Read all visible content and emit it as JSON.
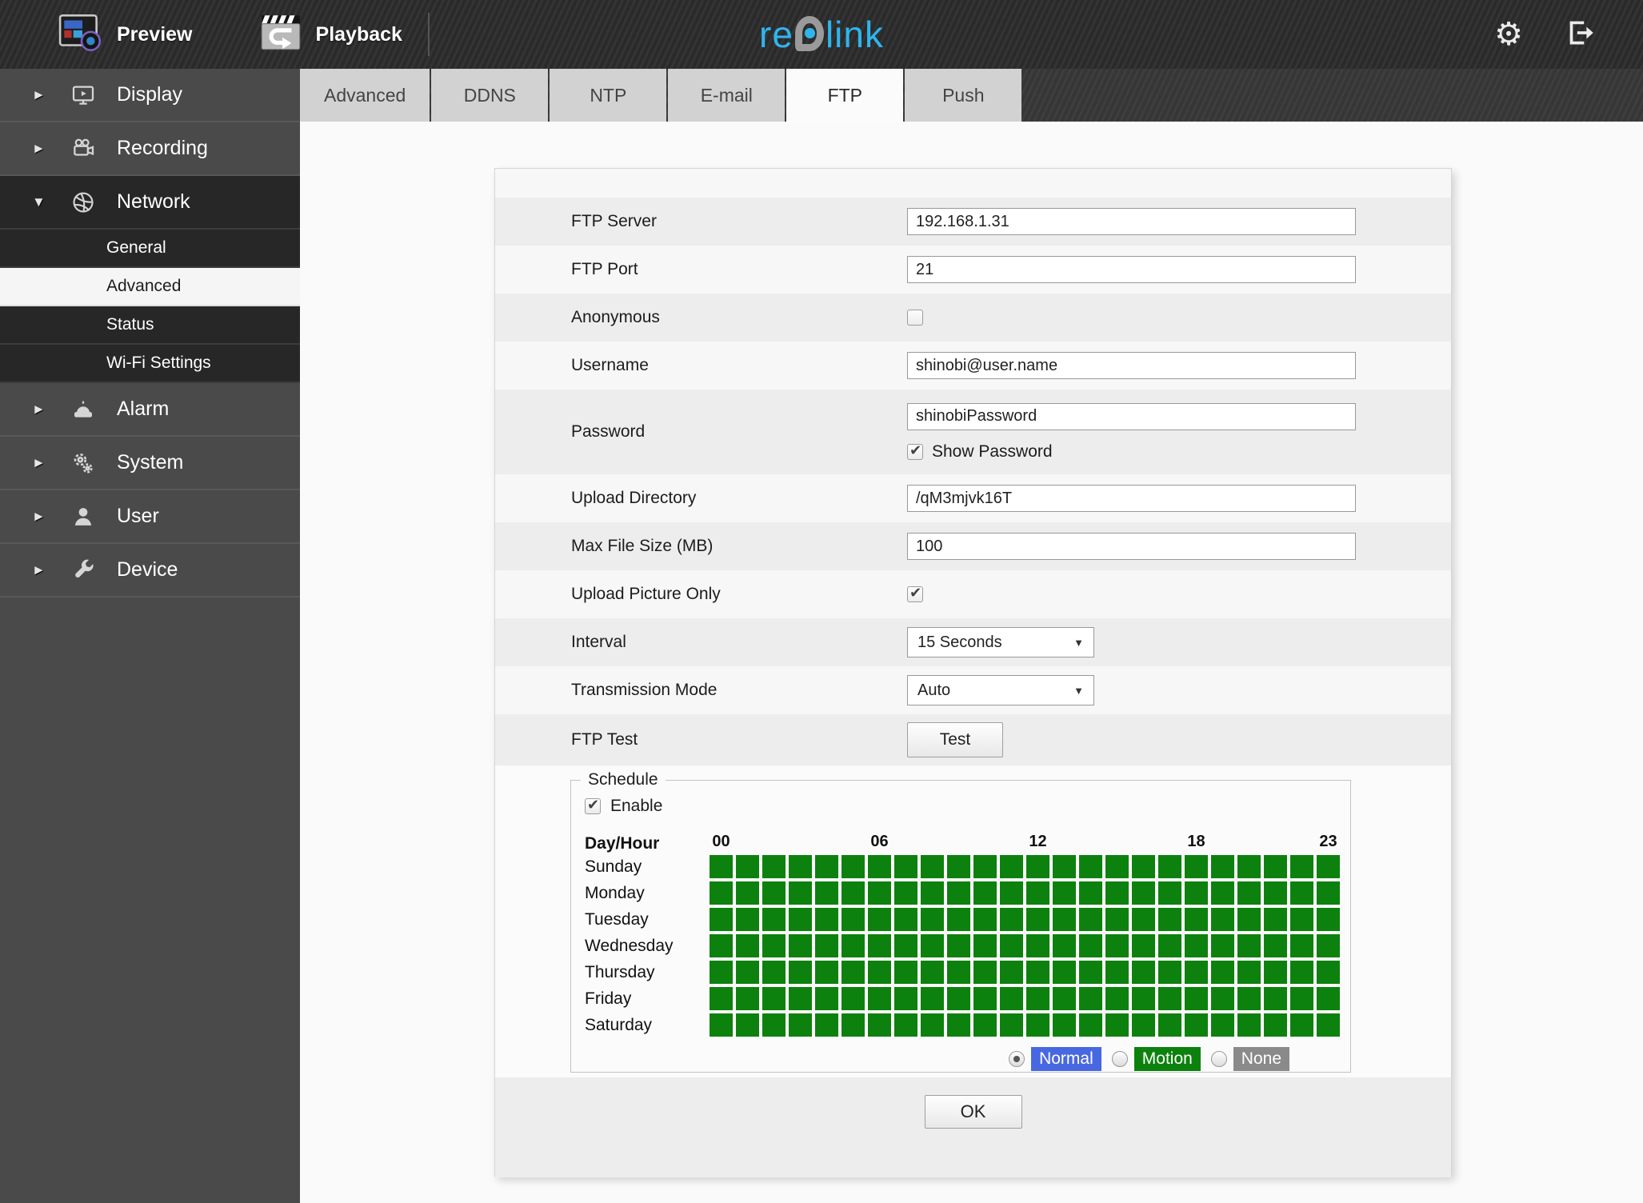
{
  "topbar": {
    "preview_label": "Preview",
    "playback_label": "Playback",
    "logo": {
      "prefix": "re",
      "suffix": "link",
      "accent_color": "#2fb5ee",
      "o_color": "#9a9a9a"
    }
  },
  "sidebar": {
    "items": [
      {
        "type": "top",
        "label": "Display",
        "icon": "display-icon",
        "expanded": false
      },
      {
        "type": "top",
        "label": "Recording",
        "icon": "recording-icon",
        "expanded": false
      },
      {
        "type": "top",
        "label": "Network",
        "icon": "network-icon",
        "expanded": true
      },
      {
        "type": "sub",
        "label": "General",
        "selected": false
      },
      {
        "type": "sub",
        "label": "Advanced",
        "selected": true
      },
      {
        "type": "sub",
        "label": "Status",
        "selected": false
      },
      {
        "type": "sub",
        "label": "Wi-Fi Settings",
        "selected": false
      },
      {
        "type": "top",
        "label": "Alarm",
        "icon": "alarm-icon",
        "expanded": false
      },
      {
        "type": "top",
        "label": "System",
        "icon": "system-icon",
        "expanded": false
      },
      {
        "type": "top",
        "label": "User",
        "icon": "user-icon",
        "expanded": false
      },
      {
        "type": "top",
        "label": "Device",
        "icon": "device-icon",
        "expanded": false
      }
    ]
  },
  "tabs": {
    "active_index": 4,
    "items": [
      "Advanced",
      "DDNS",
      "NTP",
      "E-mail",
      "FTP",
      "Push"
    ]
  },
  "form": {
    "ftp_server": {
      "label": "FTP Server",
      "value": "192.168.1.31"
    },
    "ftp_port": {
      "label": "FTP Port",
      "value": "21"
    },
    "anonymous": {
      "label": "Anonymous",
      "checked": false
    },
    "username": {
      "label": "Username",
      "value": "shinobi@user.name"
    },
    "password": {
      "label": "Password",
      "value": "shinobiPassword",
      "show_password_label": "Show Password",
      "show_password_checked": true
    },
    "upload_directory": {
      "label": "Upload Directory",
      "value": "/qM3mjvk16T"
    },
    "max_file_size": {
      "label": "Max File Size (MB)",
      "value": "100"
    },
    "upload_picture_only": {
      "label": "Upload Picture Only",
      "checked": true
    },
    "interval": {
      "label": "Interval",
      "value": "15 Seconds"
    },
    "transmission_mode": {
      "label": "Transmission Mode",
      "value": "Auto"
    },
    "ftp_test": {
      "label": "FTP Test",
      "button_label": "Test"
    }
  },
  "schedule": {
    "legend": "Schedule",
    "enable_label": "Enable",
    "enable_checked": true,
    "corner_label": "Day/Hour",
    "hour_marks": [
      {
        "label": "00",
        "col": 0
      },
      {
        "label": "06",
        "col": 6
      },
      {
        "label": "12",
        "col": 12
      },
      {
        "label": "18",
        "col": 18
      },
      {
        "label": "23",
        "col": 23
      }
    ],
    "days": [
      "Sunday",
      "Monday",
      "Tuesday",
      "Wednesday",
      "Thursday",
      "Friday",
      "Saturday"
    ],
    "hours_per_day": 24,
    "all_cells_state": "motion",
    "cell_color": "#0d810d",
    "modes": [
      {
        "label": "Normal",
        "color": "#4868e1",
        "selected": true
      },
      {
        "label": "Motion",
        "color": "#0d810d",
        "selected": false
      },
      {
        "label": "None",
        "color": "#8a8a8a",
        "selected": false
      }
    ]
  },
  "footer": {
    "ok_label": "OK"
  }
}
